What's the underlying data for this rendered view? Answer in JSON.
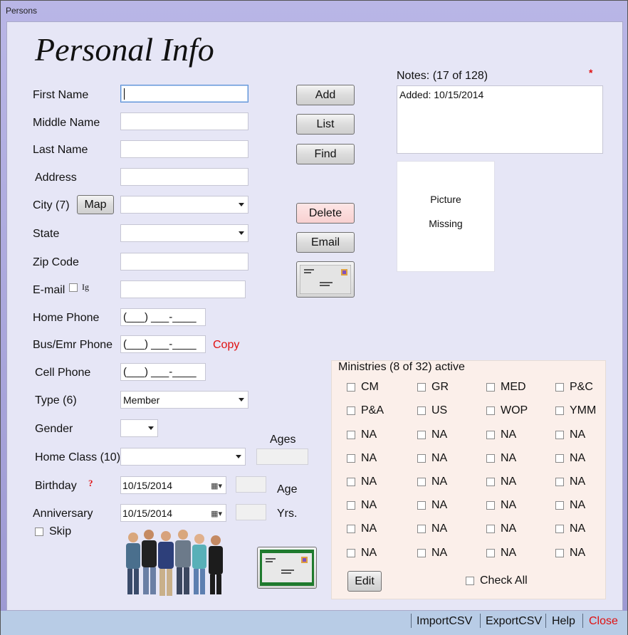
{
  "window": {
    "title": "Persons"
  },
  "header": {
    "title": "Personal Info"
  },
  "form": {
    "first_name_label": "First Name",
    "middle_name_label": "Middle Name",
    "last_name_label": "Last Name",
    "address_label": "Address",
    "city_label": "City (7)",
    "map_button": "Map",
    "state_label": "State",
    "zip_label": "Zip Code",
    "email_label": "E-mail",
    "ig_label": "Ig",
    "home_phone_label": "Home Phone",
    "home_phone_value": "(___) ___-____",
    "bus_phone_label": "Bus/Emr Phone",
    "bus_phone_value": "(___) ___-____",
    "copy_link": "Copy",
    "cell_phone_label": "Cell Phone",
    "cell_phone_value": "(___) ___-____",
    "type_label": "Type (6)",
    "type_value": "Member",
    "gender_label": "Gender",
    "ages_label": "Ages",
    "home_class_label": "Home Class (10)",
    "birthday_label": "Birthday",
    "birthday_help": "?",
    "birthday_value": "10/15/2014",
    "age_label": "Age",
    "anniversary_label": "Anniversary",
    "anniversary_value": "10/15/2014",
    "yrs_label": "Yrs.",
    "skip_label": "Skip"
  },
  "actions": {
    "add": "Add",
    "list": "List",
    "find": "Find",
    "delete": "Delete",
    "email": "Email"
  },
  "notes": {
    "label": "Notes: (17 of 128)",
    "required_mark": "*",
    "content": "Added: 10/15/2014"
  },
  "picture": {
    "line1": "Picture",
    "line2": "Missing"
  },
  "ministries": {
    "header": "Ministries (8 of 32)  active",
    "items": [
      "CM",
      "GR",
      "MED",
      "P&C",
      "P&A",
      "US",
      "WOP",
      "YMM",
      "NA",
      "NA",
      "NA",
      "NA",
      "NA",
      "NA",
      "NA",
      "NA",
      "NA",
      "NA",
      "NA",
      "NA",
      "NA",
      "NA",
      "NA",
      "NA",
      "NA",
      "NA",
      "NA",
      "NA",
      "NA",
      "NA",
      "NA",
      "NA"
    ],
    "edit_button": "Edit",
    "check_all_label": "Check All"
  },
  "statusbar": {
    "import": "ImportCSV",
    "export": "ExportCSV",
    "help": "Help",
    "close": "Close"
  },
  "colors": {
    "accent_red": "#e01010",
    "notes_bg": "#ffffff",
    "ministries_bg": "#fbefea",
    "statusbar_bg": "#b8cce6"
  }
}
